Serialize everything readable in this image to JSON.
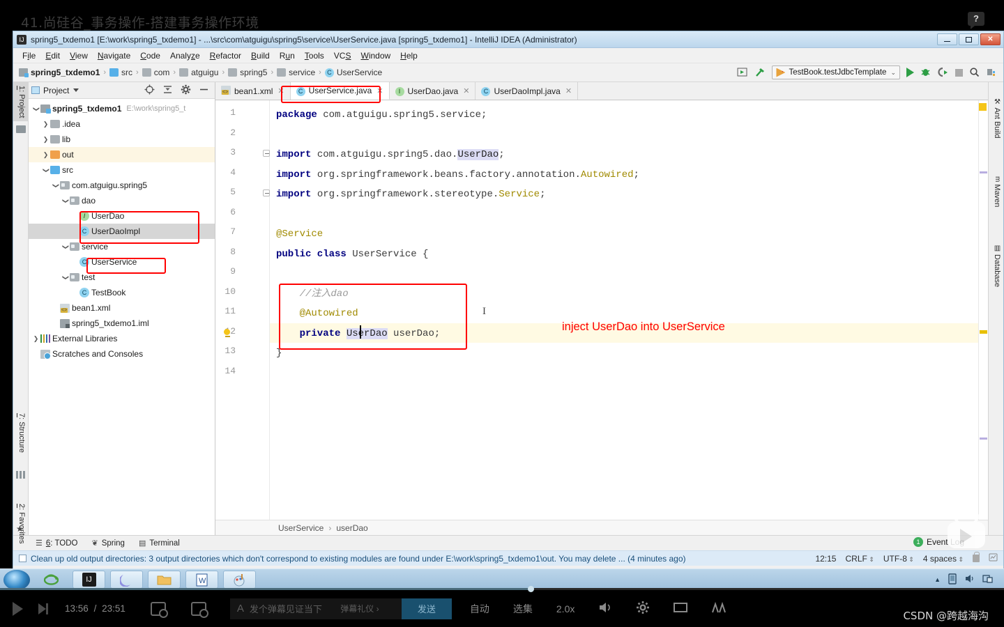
{
  "video": {
    "overlay_title": "41.尚硅谷_事务操作-搭建事务操作环境",
    "help_glyph": "?",
    "time_current": "13:56",
    "time_total": "23:51",
    "time_separator": "/",
    "danmaku_placeholder": "发个弹幕见证当下",
    "danmaku_etiquette": "弹幕礼仪 ›",
    "send_label": "发送",
    "auto_label": "自动",
    "episodes_label": "选集",
    "speed_label": "2.0x",
    "watermark": "CSDN @跨越海沟"
  },
  "window": {
    "title": "spring5_txdemo1 [E:\\work\\spring5_txdemo1] - ...\\src\\com\\atguigu\\spring5\\service\\UserService.java [spring5_txdemo1] - IntelliJ IDEA (Administrator)",
    "app_badge": "IJ"
  },
  "menu": [
    {
      "pre": "F",
      "u": "i",
      "post": "le"
    },
    {
      "pre": "",
      "u": "E",
      "post": "dit"
    },
    {
      "pre": "",
      "u": "V",
      "post": "iew"
    },
    {
      "pre": "",
      "u": "N",
      "post": "avigate"
    },
    {
      "pre": "",
      "u": "C",
      "post": "ode"
    },
    {
      "pre": "Analy",
      "u": "z",
      "post": "e"
    },
    {
      "pre": "",
      "u": "R",
      "post": "efactor"
    },
    {
      "pre": "",
      "u": "B",
      "post": "uild"
    },
    {
      "pre": "R",
      "u": "u",
      "post": "n"
    },
    {
      "pre": "",
      "u": "T",
      "post": "ools"
    },
    {
      "pre": "VC",
      "u": "S",
      "post": ""
    },
    {
      "pre": "",
      "u": "W",
      "post": "indow"
    },
    {
      "pre": "",
      "u": "H",
      "post": "elp"
    }
  ],
  "breadcrumb": {
    "items": [
      "spring5_txdemo1",
      "src",
      "com",
      "atguigu",
      "spring5",
      "service",
      "UserService"
    ],
    "separator": "›"
  },
  "toolbar": {
    "run_config": "TestBook.testJdbcTemplate",
    "chevron": "⌄"
  },
  "left_strip": [
    {
      "num": "1",
      "label": ": Project"
    },
    {
      "num": "7",
      "label": ": Structure"
    },
    {
      "num": "2",
      "label": ": Favorites"
    }
  ],
  "right_strip": [
    "Ant Build",
    "Maven",
    "Database"
  ],
  "project_panel": {
    "title": "Project",
    "tree": [
      {
        "indent": 0,
        "arrow": "d",
        "icon": "proj",
        "label": "spring5_txdemo1",
        "bold": true,
        "path": "E:\\work\\spring5_t"
      },
      {
        "indent": 1,
        "arrow": "r",
        "icon": "gray",
        "label": ".idea"
      },
      {
        "indent": 1,
        "arrow": "r",
        "icon": "gray",
        "label": "lib"
      },
      {
        "indent": 1,
        "arrow": "r",
        "icon": "orange",
        "label": "out",
        "highlight": "out"
      },
      {
        "indent": 1,
        "arrow": "d",
        "icon": "blue",
        "label": "src"
      },
      {
        "indent": 2,
        "arrow": "d",
        "icon": "pkg",
        "label": "com.atguigu.spring5"
      },
      {
        "indent": 3,
        "arrow": "d",
        "icon": "pkg",
        "label": "dao"
      },
      {
        "indent": 4,
        "arrow": "",
        "icon": "iface",
        "label": "UserDao"
      },
      {
        "indent": 4,
        "arrow": "",
        "icon": "class",
        "label": "UserDaoImpl",
        "selected": true
      },
      {
        "indent": 3,
        "arrow": "d",
        "icon": "pkg",
        "label": "service"
      },
      {
        "indent": 4,
        "arrow": "",
        "icon": "class",
        "label": "UserService"
      },
      {
        "indent": 3,
        "arrow": "d",
        "icon": "pkg",
        "label": "test"
      },
      {
        "indent": 4,
        "arrow": "",
        "icon": "class",
        "label": "TestBook"
      },
      {
        "indent": 2,
        "arrow": "",
        "icon": "xml",
        "label": "bean1.xml"
      },
      {
        "indent": 2,
        "arrow": "",
        "icon": "iml",
        "label": "spring5_txdemo1.iml"
      },
      {
        "indent": 0,
        "arrow": "r",
        "icon": "lib",
        "label": "External Libraries"
      },
      {
        "indent": 0,
        "arrow": "",
        "icon": "scratch",
        "label": "Scratches and Consoles"
      }
    ]
  },
  "editor": {
    "tabs": [
      {
        "label": "bean1.xml",
        "icon": "xml",
        "active": false
      },
      {
        "label": "UserService.java",
        "icon": "class",
        "active": true
      },
      {
        "label": "UserDao.java",
        "icon": "iface",
        "active": false
      },
      {
        "label": "UserDaoImpl.java",
        "icon": "class",
        "active": false
      }
    ],
    "line_numbers": [
      "1",
      "2",
      "3",
      "4",
      "5",
      "6",
      "7",
      "8",
      "9",
      "10",
      "11",
      "12",
      "13",
      "14"
    ],
    "lines": [
      {
        "n": 1,
        "segments": [
          {
            "t": "package",
            "c": "kw"
          },
          {
            "t": " com.atguigu.spring5.service;",
            "c": "id"
          }
        ]
      },
      {
        "n": 2,
        "segments": []
      },
      {
        "n": 3,
        "segments": [
          {
            "t": "import",
            "c": "kw"
          },
          {
            "t": " com.atguigu.spring5.dao.",
            "c": "id"
          },
          {
            "t": "UserDao",
            "c": "type-hl"
          },
          {
            "t": ";",
            "c": "id"
          }
        ]
      },
      {
        "n": 4,
        "segments": [
          {
            "t": "import",
            "c": "kw"
          },
          {
            "t": " org.springframework.beans.factory.annotation.",
            "c": "id"
          },
          {
            "t": "Autowired",
            "c": "anno"
          },
          {
            "t": ";",
            "c": "id"
          }
        ]
      },
      {
        "n": 5,
        "segments": [
          {
            "t": "import",
            "c": "kw"
          },
          {
            "t": " org.springframework.stereotype.",
            "c": "id"
          },
          {
            "t": "Service",
            "c": "anno"
          },
          {
            "t": ";",
            "c": "id"
          }
        ]
      },
      {
        "n": 6,
        "segments": []
      },
      {
        "n": 7,
        "segments": [
          {
            "t": "@Service",
            "c": "anno"
          }
        ]
      },
      {
        "n": 8,
        "segments": [
          {
            "t": "public class",
            "c": "kw"
          },
          {
            "t": " UserService {",
            "c": "id"
          }
        ]
      },
      {
        "n": 9,
        "segments": []
      },
      {
        "n": 10,
        "segments": [
          {
            "t": "    //注入dao",
            "c": "cmt"
          }
        ]
      },
      {
        "n": 11,
        "segments": [
          {
            "t": "    @Autowired",
            "c": "anno"
          }
        ]
      },
      {
        "n": 12,
        "segments": [
          {
            "t": "    private ",
            "c": "kw"
          },
          {
            "t": "UserDao",
            "c": "type-hl"
          },
          {
            "t": " userDao;",
            "c": "id"
          }
        ],
        "current": true
      },
      {
        "n": 13,
        "segments": [
          {
            "t": "}",
            "c": "id"
          }
        ]
      },
      {
        "n": 14,
        "segments": []
      }
    ],
    "annotation": "inject UserDao into UserService",
    "breadcrumb": [
      "UserService",
      "userDao"
    ],
    "breadcrumb_sep": "›"
  },
  "bottom_tools": [
    {
      "num": "6",
      "label": ": TODO",
      "icon": "todo-icon"
    },
    {
      "num": "",
      "label": "Spring",
      "icon": "spring-leaf-icon"
    },
    {
      "num": "",
      "label": "Terminal",
      "icon": "terminal-icon"
    }
  ],
  "status": {
    "notification": "Clean up old output directories: 3 output directories which don't correspond to existing modules are found under E:\\work\\spring5_txdemo1\\out. You may delete ... (4 minutes ago)",
    "event_log": "Event Log",
    "event_count": "1",
    "position": "12:15",
    "line_sep": "CRLF",
    "encoding": "UTF-8",
    "indent": "4 spaces",
    "arrows": "⇕"
  }
}
